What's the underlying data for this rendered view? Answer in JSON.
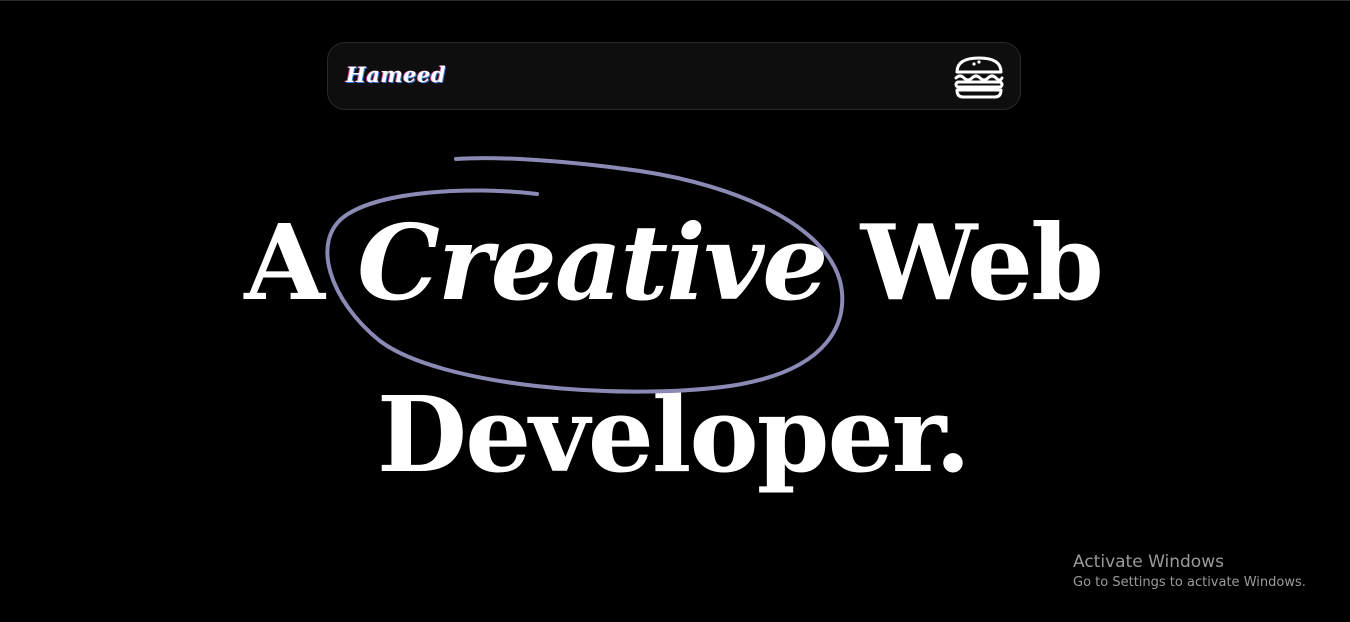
{
  "navbar": {
    "logo_text": "Hameed",
    "menu_icon": "hamburger-menu-icon"
  },
  "hero": {
    "line1_before": "A ",
    "line1_highlight": "Creative",
    "line1_after": " Web",
    "line2": "Developer."
  },
  "colors": {
    "background": "#000000",
    "text": "#ffffff",
    "scribble": "#8a8ab5"
  },
  "watermark": {
    "title": "Activate Windows",
    "subtitle": "Go to Settings to activate Windows."
  }
}
